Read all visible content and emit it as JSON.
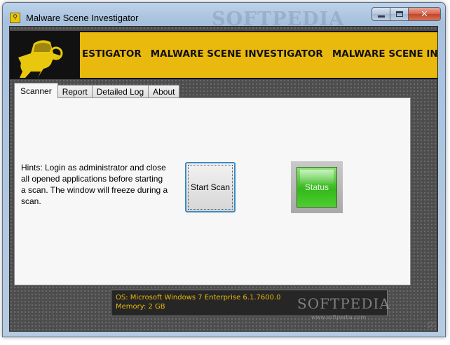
{
  "window": {
    "title": "Malware Scene Investigator",
    "title_watermark": "SOFTPEDIA"
  },
  "banner": {
    "marquee": [
      "ESTIGATOR",
      "MALWARE SCENE INVESTIGATOR",
      "MALWARE SCENE INV"
    ],
    "accent_color": "#e9b90d"
  },
  "tabs": [
    {
      "label": "Scanner",
      "active": true
    },
    {
      "label": "Report",
      "active": false
    },
    {
      "label": "Detailed Log",
      "active": false
    },
    {
      "label": "About",
      "active": false
    }
  ],
  "scanner": {
    "hints": "Hints: Login as administrator and close all opened applications before starting a scan. The window will freeze during a scan.",
    "start_button": "Start Scan",
    "status_label": "Status",
    "status_color": "#35b81d"
  },
  "sysinfo": {
    "os": "OS: Microsoft Windows 7 Enterprise  6.1.7600.0",
    "memory": "Memory: 2 GB",
    "text_color": "#e8b80a"
  },
  "watermark": {
    "logo": "SOFTPEDIA",
    "url": "www.softpedia.com"
  }
}
